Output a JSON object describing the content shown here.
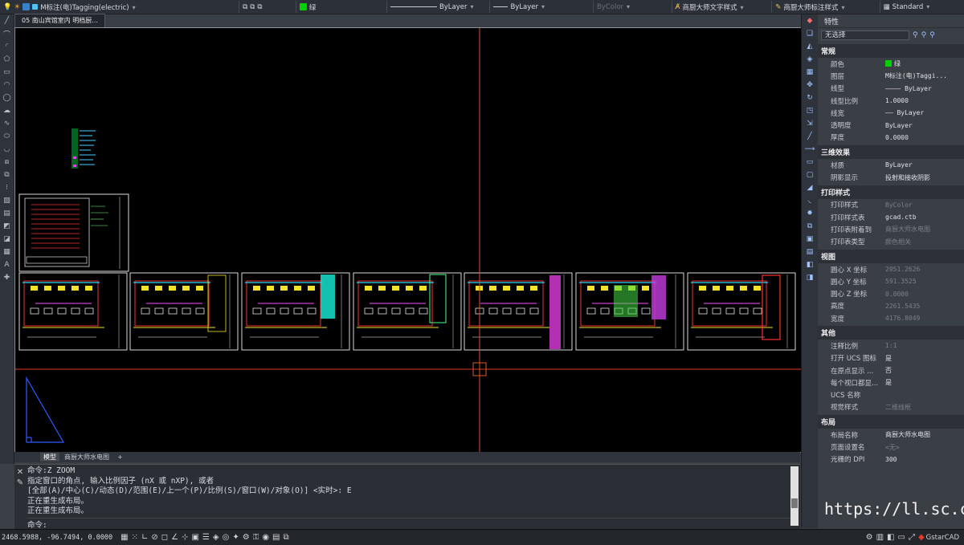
{
  "toolbar": {
    "layer_name": "M标注(电)Tagging(electric)",
    "color": "绿",
    "linetype": "ByLayer",
    "lineweight": "ByLayer",
    "plotstyle": "ByColor",
    "text_style": "商厨大师文字样式",
    "dim_style": "商厨大师标注样式",
    "table_style": "Standard",
    "colors": {
      "green": "#00d000",
      "accent": "#5a8fe6"
    }
  },
  "document_tab": "05 南山宾馆室内 明档厨...",
  "layout_tabs": {
    "model": "模型",
    "layout1": "商厨大师水电图",
    "add": "+"
  },
  "command": {
    "lines": [
      "命令:Z ZOOM",
      "指定窗口的角点, 输入比例因子 (nX 或 nXP), 或者",
      "[全部(A)/中心(C)/动态(D)/范围(E)/上一个(P)/比例(S)/窗口(W)/对象(O)] <实时>: E",
      "正在重生成布局。",
      "正在重生成布局。"
    ],
    "prompt": "命令:"
  },
  "status": {
    "coords": "2468.5988, -96.7494, 0.0000",
    "app": "GstarCAD"
  },
  "properties": {
    "title": "特性",
    "selection": "无选择",
    "sections": [
      {
        "title": "常规",
        "rows": [
          {
            "k": "颜色",
            "v": "绿",
            "swatch": "#00d000"
          },
          {
            "k": "图层",
            "v": "M标注(电)Taggi..."
          },
          {
            "k": "线型",
            "v": "———— ByLayer"
          },
          {
            "k": "线型比例",
            "v": "1.0000"
          },
          {
            "k": "线宽",
            "v": "—— ByLayer"
          },
          {
            "k": "透明度",
            "v": "ByLayer"
          },
          {
            "k": "厚度",
            "v": "0.0000"
          }
        ]
      },
      {
        "title": "三维效果",
        "rows": [
          {
            "k": "材质",
            "v": "ByLayer"
          },
          {
            "k": "阴影显示",
            "v": "投射和接收阴影"
          }
        ]
      },
      {
        "title": "打印样式",
        "rows": [
          {
            "k": "打印样式",
            "v": "ByColor",
            "dim": true
          },
          {
            "k": "打印样式表",
            "v": "gcad.ctb"
          },
          {
            "k": "打印表附着到",
            "v": "商厨大师水电图",
            "dim": true
          },
          {
            "k": "打印表类型",
            "v": "颜色相关",
            "dim": true
          }
        ]
      },
      {
        "title": "视图",
        "rows": [
          {
            "k": "圆心 X 坐标",
            "v": "2051.2626",
            "dim": true
          },
          {
            "k": "圆心 Y 坐标",
            "v": "591.3525",
            "dim": true
          },
          {
            "k": "圆心 Z 坐标",
            "v": "0.0000",
            "dim": true
          },
          {
            "k": "高度",
            "v": "2261.5435",
            "dim": true
          },
          {
            "k": "宽度",
            "v": "4176.8049",
            "dim": true
          }
        ]
      },
      {
        "title": "其他",
        "rows": [
          {
            "k": "注释比例",
            "v": "1:1",
            "dim": true
          },
          {
            "k": "打开 UCS 图标",
            "v": "是"
          },
          {
            "k": "在原点显示 ...",
            "v": "否"
          },
          {
            "k": "每个视口都显...",
            "v": "是"
          },
          {
            "k": "UCS 名称",
            "v": ""
          },
          {
            "k": "视觉样式",
            "v": "二维线框",
            "dim": true
          }
        ]
      },
      {
        "title": "布局",
        "rows": [
          {
            "k": "布局名称",
            "v": "商厨大师水电图"
          },
          {
            "k": "页面设置名",
            "v": "<无>",
            "dim": true
          },
          {
            "k": "光栅的 DPI",
            "v": "300"
          }
        ]
      }
    ]
  },
  "watermark": "https://ll.sc.cn"
}
